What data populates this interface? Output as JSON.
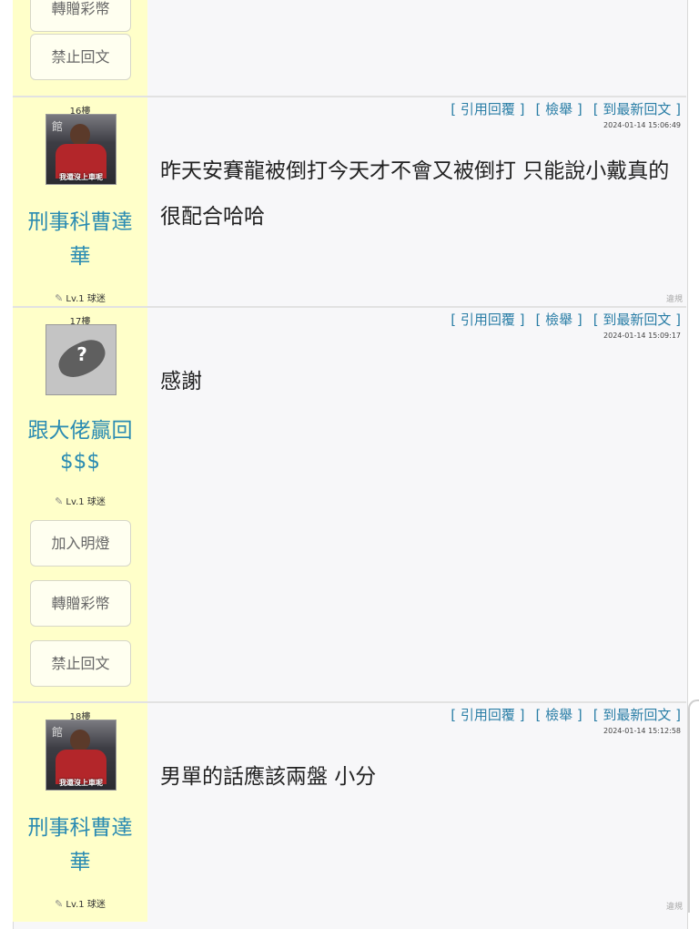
{
  "top_partial": {
    "button_cut": "轉贈彩幣",
    "button_ban": "禁止回文"
  },
  "actions": {
    "quote": "[ 引用回覆 ]",
    "report_post": "[ 檢舉 ]",
    "latest": "[ 到最新回文 ]"
  },
  "report_link": "違規",
  "posts": [
    {
      "floor": "16樓",
      "avatar_caption": "我還沒上車呢",
      "avatar_sign": "館",
      "username": "刑事科曹達華",
      "level": "Lv.1 球迷",
      "timestamp": "2024-01-14 15:06:49",
      "message": "昨天安賽龍被倒打今天才不會又被倒打 只能說小戴真的很配合哈哈"
    },
    {
      "floor": "17樓",
      "username": "跟大佬贏回$$$",
      "level": "Lv.1 球迷",
      "timestamp": "2024-01-14 15:09:17",
      "message": "感謝",
      "buttons": [
        "加入明燈",
        "轉贈彩幣",
        "禁止回文"
      ]
    },
    {
      "floor": "18樓",
      "avatar_caption": "我還沒上車呢",
      "avatar_sign": "館",
      "username": "刑事科曹達華",
      "level": "Lv.1 球迷",
      "timestamp": "2024-01-14 15:12:58",
      "message": "男單的話應該兩盤 小分"
    }
  ],
  "colors": {
    "sidebar_bg": "#ffffc9",
    "username": "#2a8bb2",
    "action_link": "#2a7ea6"
  },
  "icons": {
    "level": "pencil-icon",
    "avatar_default": "unknown-user-icon"
  }
}
